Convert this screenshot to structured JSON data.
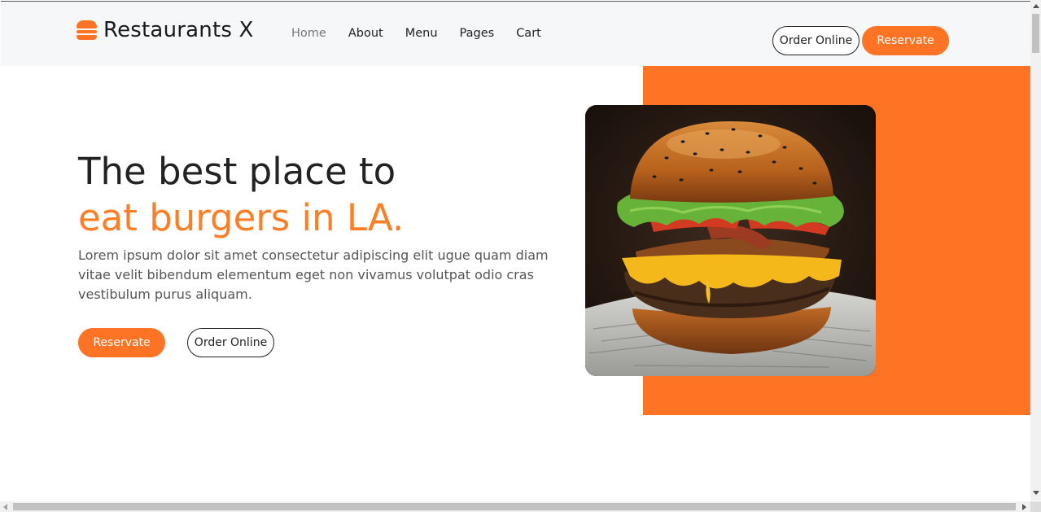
{
  "brand": {
    "name": "Restaurants X",
    "icon": "burger-icon"
  },
  "nav": {
    "items": [
      {
        "label": "Home",
        "active": true
      },
      {
        "label": "About",
        "active": false
      },
      {
        "label": "Menu",
        "active": false
      },
      {
        "label": "Pages",
        "active": false
      },
      {
        "label": "Cart",
        "active": false
      }
    ]
  },
  "header_buttons": {
    "order_label": "Order Online",
    "reserve_label": "Reservate"
  },
  "hero": {
    "title_line1": "The best place to",
    "title_line2": "eat burgers in LA.",
    "description": "Lorem ipsum dolor sit amet consectetur adipiscing elit ugue quam diam vitae velit bibendum elementum eget non vivamus volutpat odio cras vestibulum purus aliquam.",
    "reserve_label": "Reservate",
    "order_label": "Order Online",
    "image": "burger-photo"
  },
  "colors": {
    "accent": "#ff7324",
    "header_bg": "#f6f7f9",
    "text": "#222222"
  }
}
